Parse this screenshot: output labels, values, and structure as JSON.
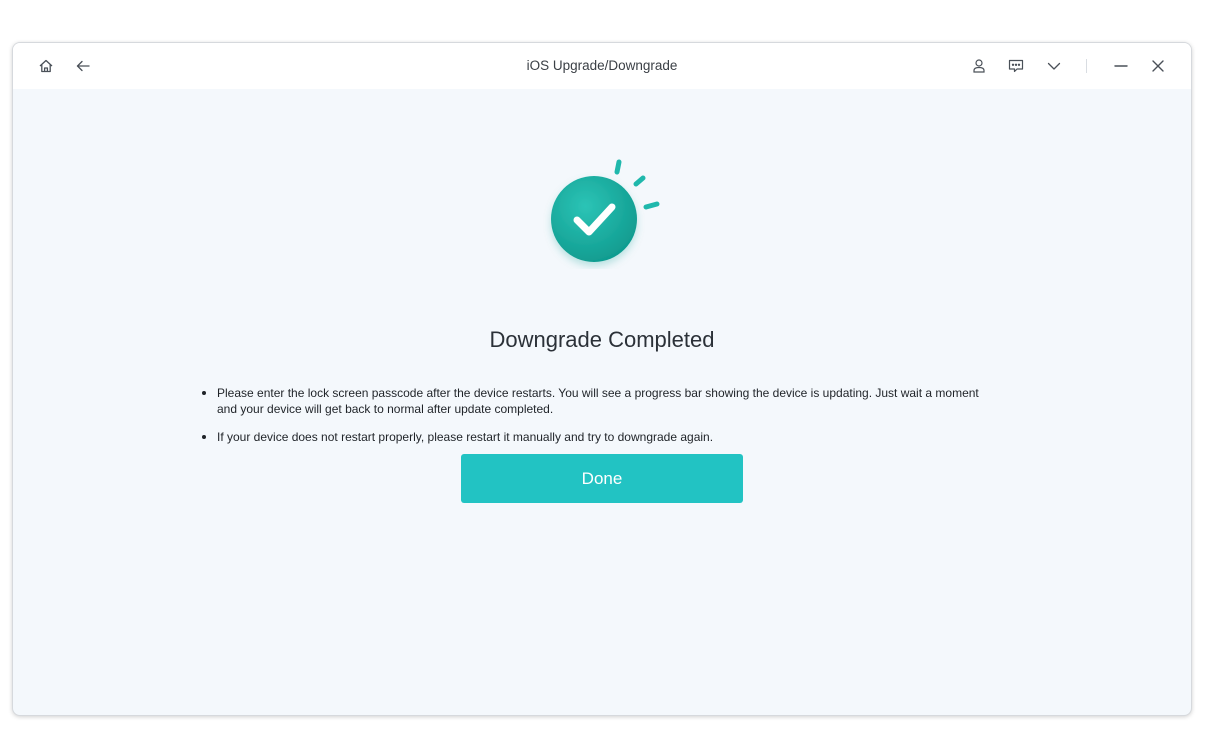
{
  "window": {
    "title": "iOS Upgrade/Downgrade"
  },
  "titlebar": {
    "left_icons": [
      "home-icon",
      "back-arrow-icon"
    ],
    "right_icons": [
      "user-icon",
      "feedback-icon",
      "chevron-down-icon",
      "minimize-icon",
      "close-icon"
    ]
  },
  "main": {
    "status_icon": "check-circle-icon",
    "heading": "Downgrade Completed",
    "notes": [
      "Please enter the lock screen passcode after the device restarts. You will see a progress bar showing the device is updating. Just wait a moment and your device will get back to normal after update completed.",
      "If your device does not restart properly, please restart it manually and try to downgrade again."
    ],
    "done_label": "Done"
  },
  "colors": {
    "accent": "#22c3c3",
    "success_circle": "#16a89c",
    "background": "#f4f8fc"
  }
}
